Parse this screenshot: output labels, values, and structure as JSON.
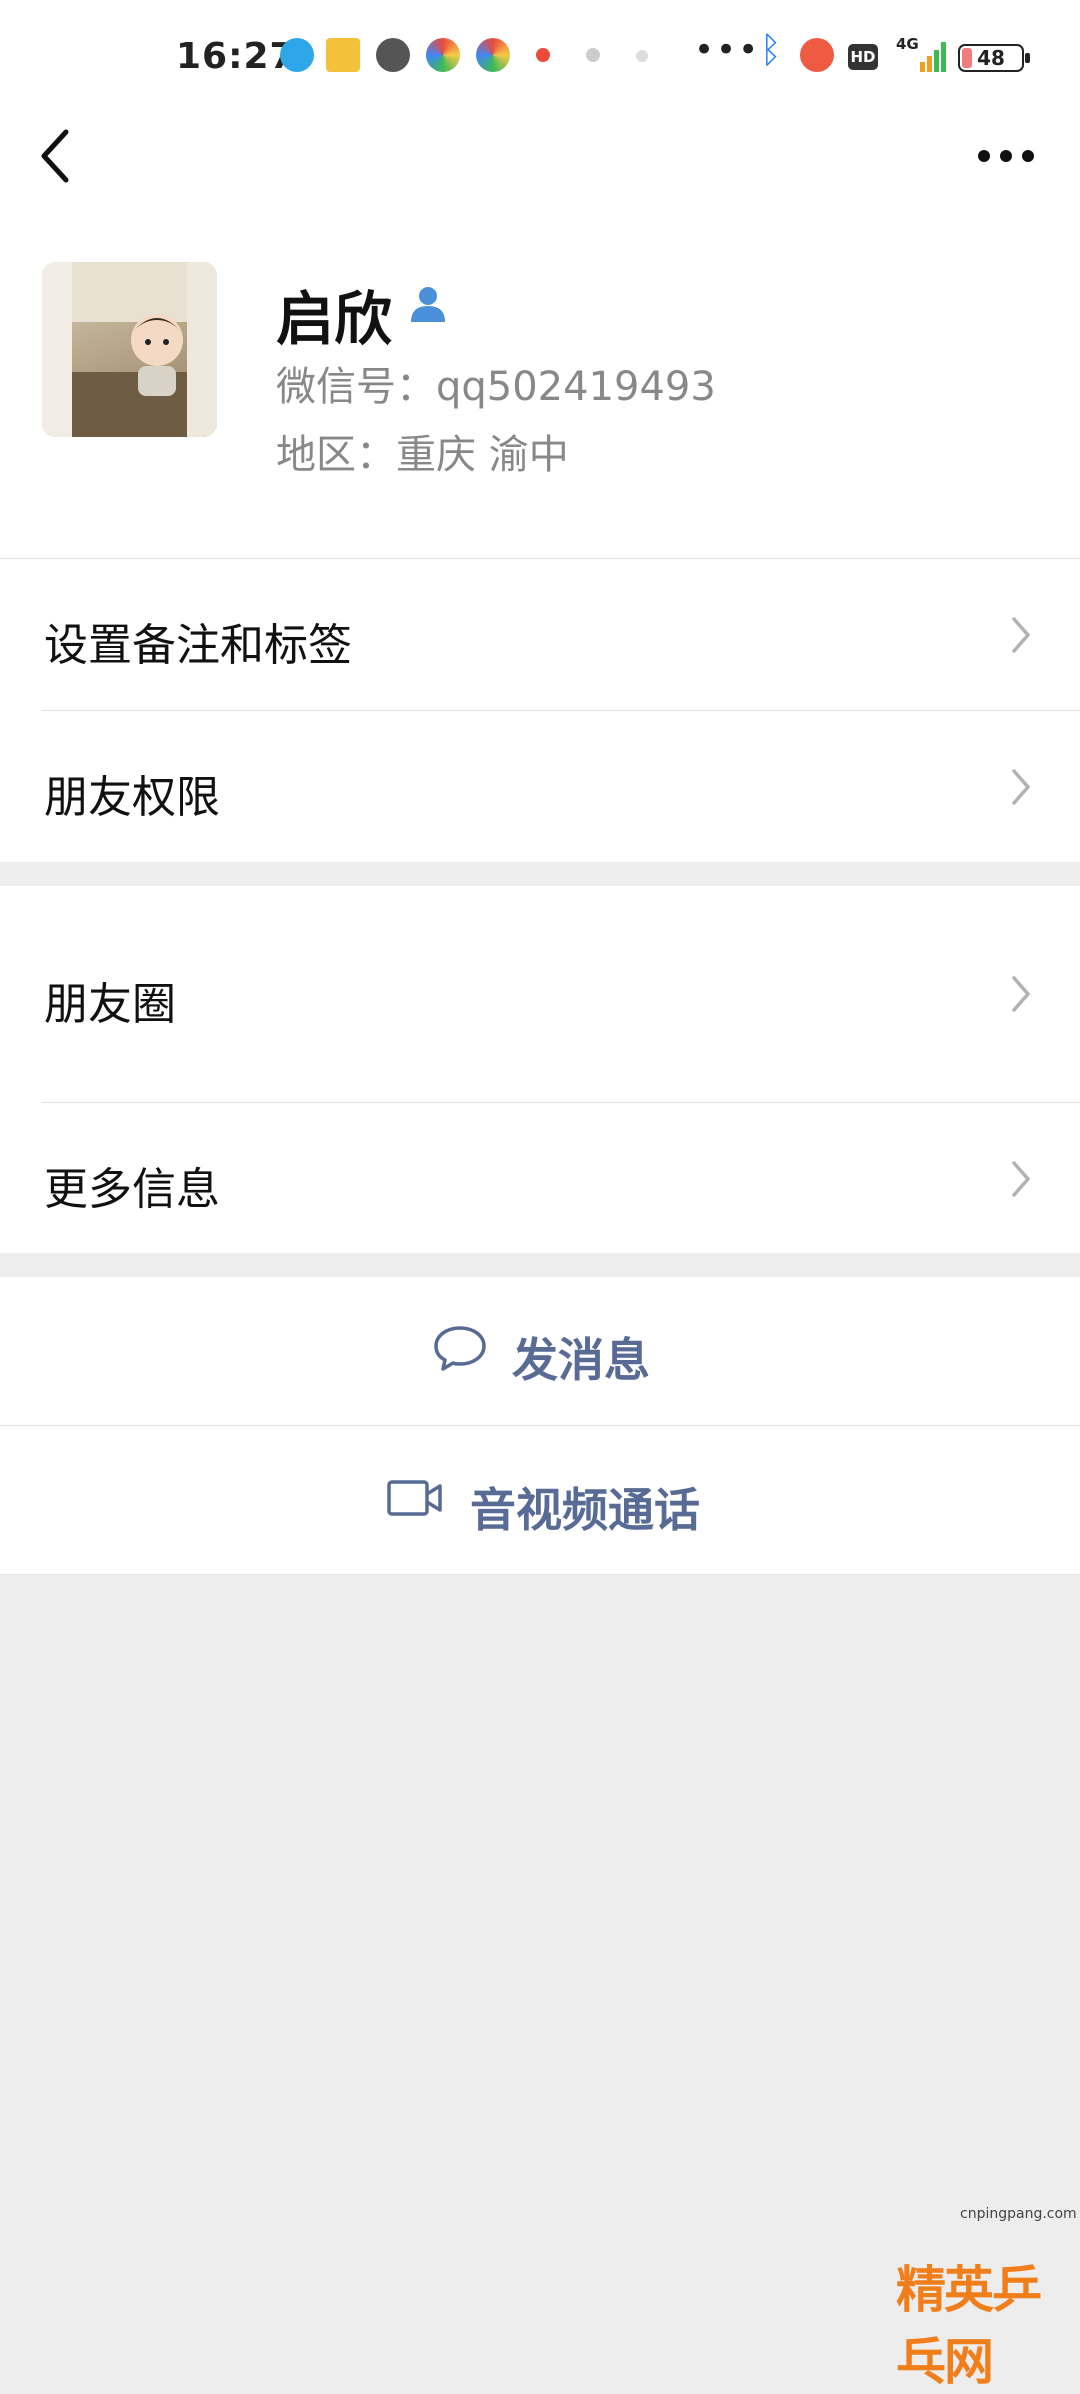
{
  "status_bar": {
    "time": "16:27",
    "network": "4G",
    "battery": "48",
    "hd": "HD",
    "overflow": "•••"
  },
  "nav": {
    "back_icon": "chevron-left-icon",
    "more_icon": "more-dots-icon"
  },
  "profile": {
    "name": "启欣",
    "wechat_id": "微信号：qq502419493",
    "region": "地区：重庆  渝中"
  },
  "menu": {
    "remarks": "设置备注和标签",
    "permissions": "朋友权限",
    "moments": "朋友圈",
    "more_info": "更多信息"
  },
  "actions": {
    "send_message": "发消息",
    "av_call": "音视频通话"
  },
  "watermark": {
    "url": "cnpingpang.com",
    "text": "精英乒乓网"
  },
  "colors": {
    "action": "#576b95",
    "background": "#ededed",
    "blue_icon": "#4a90d9"
  }
}
